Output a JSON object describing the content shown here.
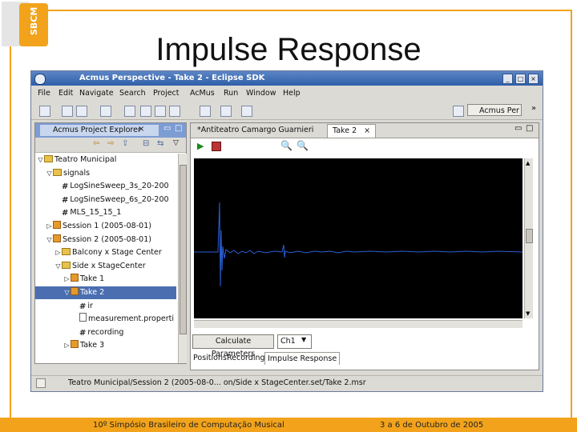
{
  "slide": {
    "title": "Impulse Response",
    "footer_left": "10º Simpósio Brasileiro de Computação Musical",
    "footer_right": "3 a 6 de Outubro de 2005",
    "logo_text": "SBCM",
    "accent_color": "#f2a31b"
  },
  "window": {
    "title": "Acmus Perspective - Take 2 - Eclipse SDK",
    "controls": [
      "_",
      "□",
      "×"
    ],
    "menu": [
      "File",
      "Edit",
      "Navigate",
      "Search",
      "Project",
      "AcMus",
      "Run",
      "Window",
      "Help"
    ],
    "perspective_label": "Acmus Per",
    "perspective_more": "»"
  },
  "project_explorer": {
    "tab_label": "Acmus Project Explorer",
    "tab_close": "×",
    "tree": [
      {
        "indent": 0,
        "twisty": "▽",
        "icon": "folder",
        "label": "Teatro Municipal",
        "selected": false
      },
      {
        "indent": 1,
        "twisty": "▽",
        "icon": "folder",
        "label": "signals",
        "selected": false
      },
      {
        "indent": 2,
        "twisty": "",
        "icon": "hash",
        "label": "LogSineSweep_3s_20-200",
        "selected": false
      },
      {
        "indent": 2,
        "twisty": "",
        "icon": "hash",
        "label": "LogSineSweep_6s_20-200",
        "selected": false
      },
      {
        "indent": 2,
        "twisty": "",
        "icon": "hash",
        "label": "MLS_15_15_1",
        "selected": false
      },
      {
        "indent": 1,
        "twisty": "▷",
        "icon": "orange",
        "label": "Session 1 (2005-08-01)",
        "selected": false
      },
      {
        "indent": 1,
        "twisty": "▽",
        "icon": "orange",
        "label": "Session 2 (2005-08-01)",
        "selected": false
      },
      {
        "indent": 2,
        "twisty": "▷",
        "icon": "folder",
        "label": "Balcony x Stage Center",
        "selected": false
      },
      {
        "indent": 2,
        "twisty": "▽",
        "icon": "folder",
        "label": "Side x StageCenter",
        "selected": false
      },
      {
        "indent": 3,
        "twisty": "▷",
        "icon": "orange",
        "label": "Take 1",
        "selected": false
      },
      {
        "indent": 3,
        "twisty": "▽",
        "icon": "orange",
        "label": "Take 2",
        "selected": true
      },
      {
        "indent": 4,
        "twisty": "",
        "icon": "hash",
        "label": "ir",
        "selected": false
      },
      {
        "indent": 4,
        "twisty": "",
        "icon": "doc",
        "label": "measurement.properti",
        "selected": false
      },
      {
        "indent": 4,
        "twisty": "",
        "icon": "hash",
        "label": "recording",
        "selected": false
      },
      {
        "indent": 3,
        "twisty": "▷",
        "icon": "orange",
        "label": "Take 3",
        "selected": false
      }
    ]
  },
  "editor": {
    "tabs": [
      "*Antiteatro Camargo Guarnieri",
      "Take 2"
    ],
    "active_tab": "Take 2",
    "tab_close": "×",
    "calculate_button": "Calculate Parameters",
    "channel_select": "Ch1",
    "bottom_tabs": [
      "Positions",
      "Recording",
      "Impulse Response"
    ],
    "active_bottom_tab": "Impulse Response"
  },
  "status": {
    "path": "Teatro Municipal/Session 2 (2005-08-0... on/Side x StageCenter.set/Take 2.msr"
  }
}
